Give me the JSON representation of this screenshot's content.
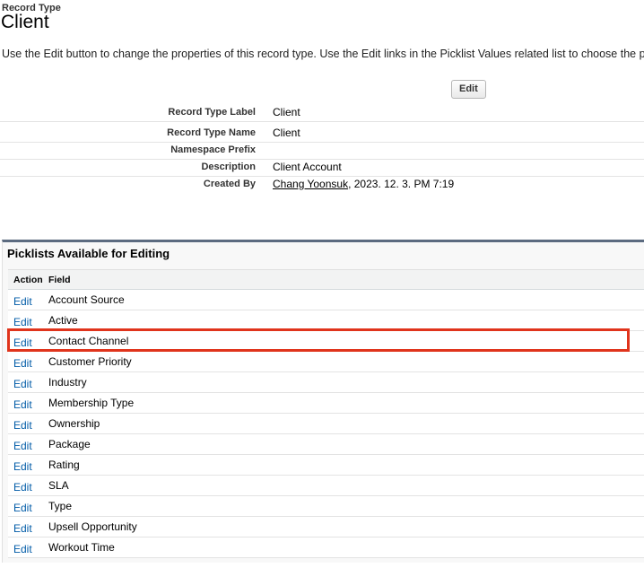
{
  "header": {
    "record_type_label": "Record Type",
    "title": "Client",
    "description": "Use the Edit button to change the properties of this record type. Use the Edit links in the Picklist Values related list to choose the pic"
  },
  "toolbar": {
    "edit_label": "Edit"
  },
  "details": {
    "record_type_label": {
      "label": "Record Type Label",
      "value": "Client"
    },
    "record_type_name": {
      "label": "Record Type Name",
      "value": "Client"
    },
    "namespace_prefix": {
      "label": "Namespace Prefix",
      "value": ""
    },
    "description": {
      "label": "Description",
      "value": "Client Account"
    },
    "created_by": {
      "label": "Created By",
      "user": "Chang Yoonsuk",
      "date": ", 2023. 12. 3. PM 7:19"
    }
  },
  "picklists": {
    "title": "Picklists Available for Editing",
    "columns": {
      "action": "Action",
      "field": "Field"
    },
    "action_label": "Edit",
    "rows": [
      "Account Source",
      "Active",
      "Contact Channel",
      "Customer Priority",
      "Industry",
      "Membership Type",
      "Ownership",
      "Package",
      "Rating",
      "SLA",
      "Type",
      "Upsell Opportunity",
      "Workout Time"
    ],
    "highlighted_row": "Contact Channel"
  },
  "colors": {
    "link": "#015ba7",
    "panel_border": "#5c6b80",
    "highlight": "#e0341c"
  }
}
